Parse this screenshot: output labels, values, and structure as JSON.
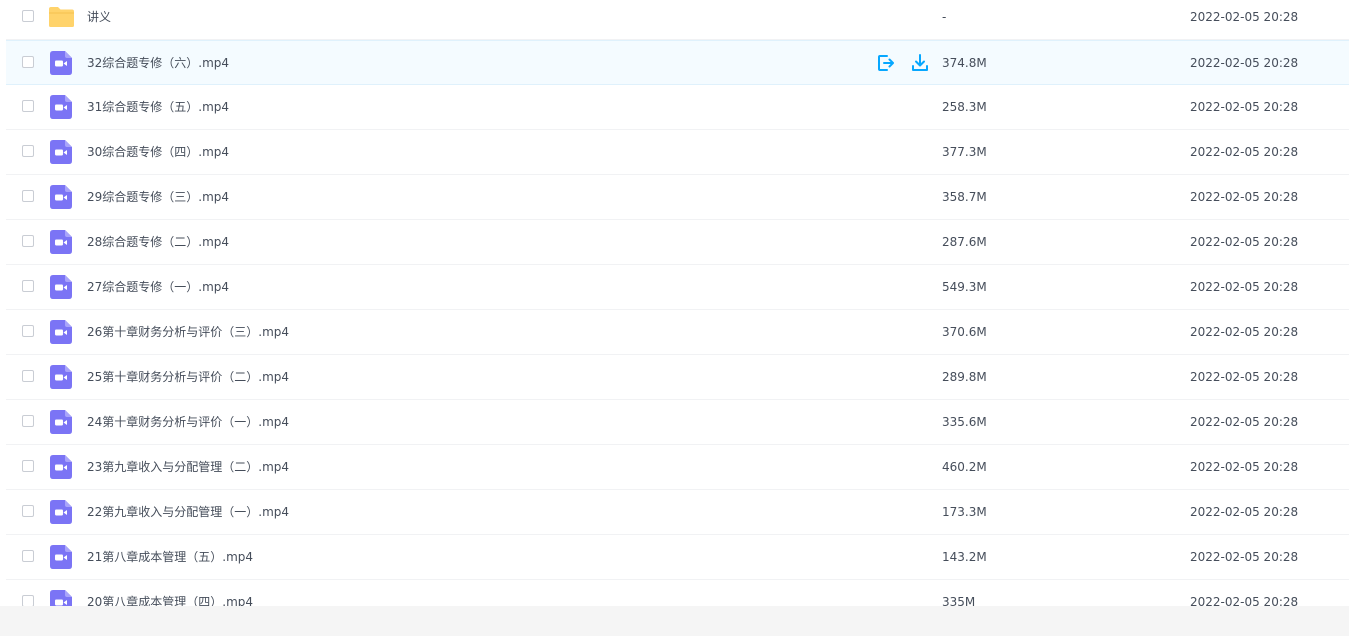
{
  "colors": {
    "folder": "#ffd36b",
    "video_icon": "#7b74f5",
    "action_icon": "#06a7ff",
    "hover_row": "#f4fbff"
  },
  "hover_actions": [
    {
      "name": "share-icon",
      "label": ""
    },
    {
      "name": "download-icon",
      "label": ""
    }
  ],
  "files": [
    {
      "name": "讲义",
      "type": "folder",
      "size": "-",
      "date": "2022-02-05 20:28"
    },
    {
      "name": "32综合题专修（六）.mp4",
      "type": "video",
      "size": "374.8M",
      "date": "2022-02-05 20:28",
      "hovered": true
    },
    {
      "name": "31综合题专修（五）.mp4",
      "type": "video",
      "size": "258.3M",
      "date": "2022-02-05 20:28"
    },
    {
      "name": "30综合题专修（四）.mp4",
      "type": "video",
      "size": "377.3M",
      "date": "2022-02-05 20:28"
    },
    {
      "name": "29综合题专修（三）.mp4",
      "type": "video",
      "size": "358.7M",
      "date": "2022-02-05 20:28"
    },
    {
      "name": "28综合题专修（二）.mp4",
      "type": "video",
      "size": "287.6M",
      "date": "2022-02-05 20:28"
    },
    {
      "name": "27综合题专修（一）.mp4",
      "type": "video",
      "size": "549.3M",
      "date": "2022-02-05 20:28"
    },
    {
      "name": "26第十章财务分析与评价（三）.mp4",
      "type": "video",
      "size": "370.6M",
      "date": "2022-02-05 20:28"
    },
    {
      "name": "25第十章财务分析与评价（二）.mp4",
      "type": "video",
      "size": "289.8M",
      "date": "2022-02-05 20:28"
    },
    {
      "name": "24第十章财务分析与评价（一）.mp4",
      "type": "video",
      "size": "335.6M",
      "date": "2022-02-05 20:28"
    },
    {
      "name": "23第九章收入与分配管理（二）.mp4",
      "type": "video",
      "size": "460.2M",
      "date": "2022-02-05 20:28"
    },
    {
      "name": "22第九章收入与分配管理（一）.mp4",
      "type": "video",
      "size": "173.3M",
      "date": "2022-02-05 20:28"
    },
    {
      "name": "21第八章成本管理（五）.mp4",
      "type": "video",
      "size": "143.2M",
      "date": "2022-02-05 20:28"
    },
    {
      "name": "20第八章成本管理（四）.mp4",
      "type": "video",
      "size": "335M",
      "date": "2022-02-05 20:28"
    }
  ]
}
